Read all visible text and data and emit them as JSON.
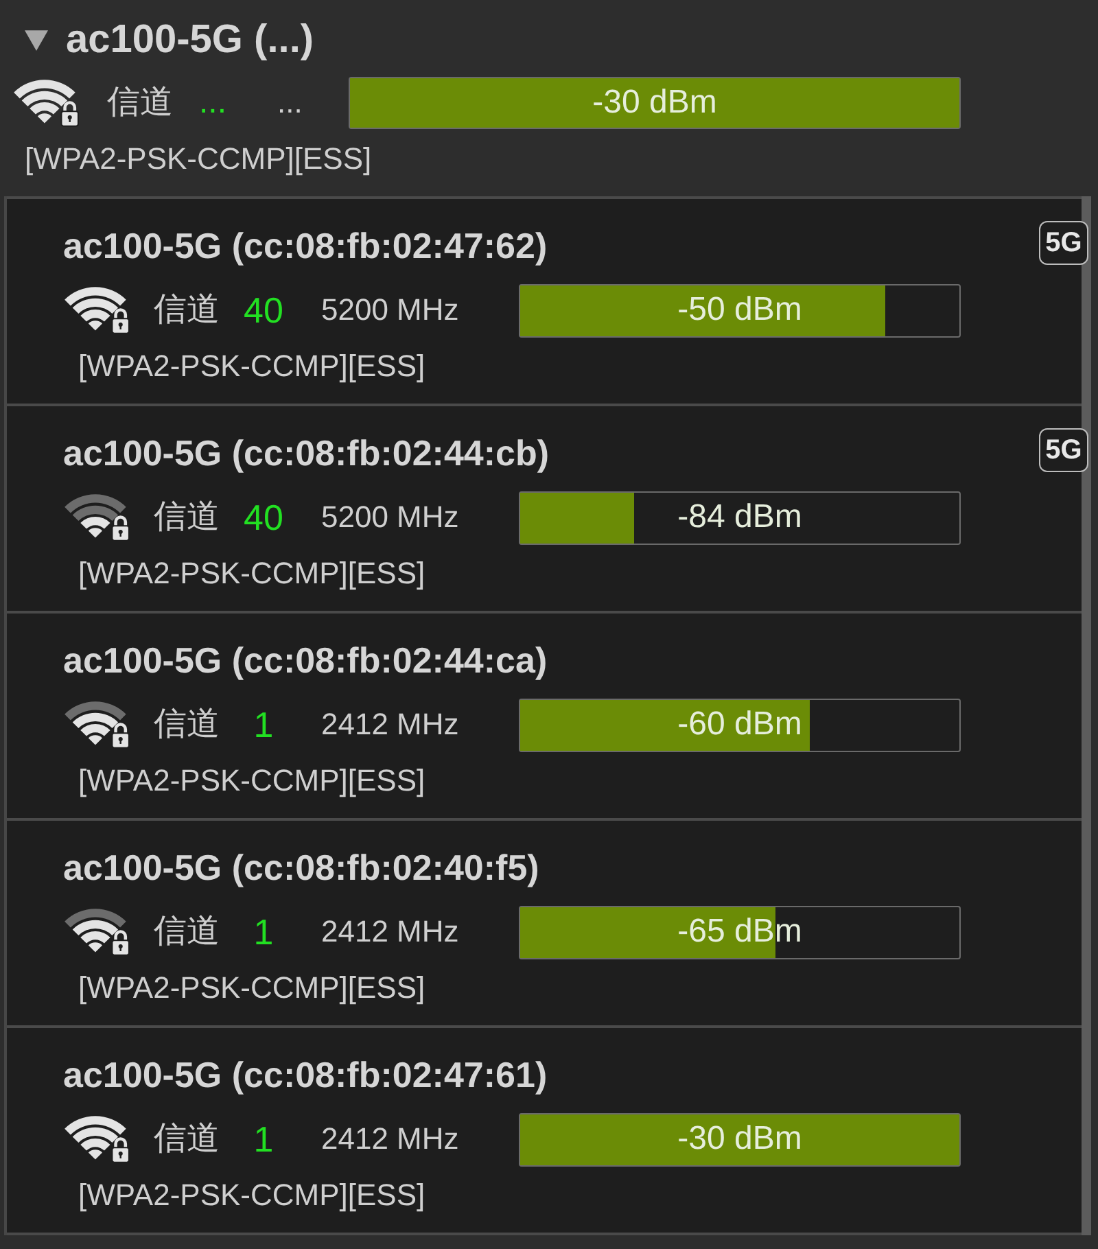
{
  "group": {
    "title": "ac100-5G (...)",
    "expanded": true,
    "channel_label": "信道",
    "channel": "...",
    "frequency": "...",
    "level": 1,
    "reading": "-30 dBm",
    "security": "[WPA2-PSK-CCMP][ESS]"
  },
  "networks": [
    {
      "name": "ac100-5G (cc:08:fb:02:47:62)",
      "band": "5G",
      "channel_label": "信道",
      "channel": "40",
      "frequency": "5200 MHz",
      "level": 0.83,
      "reading": "-50 dBm",
      "security": "[WPA2-PSK-CCMP][ESS]"
    },
    {
      "name": "ac100-5G (cc:08:fb:02:44:cb)",
      "band": "5G",
      "channel_label": "信道",
      "channel": "40",
      "frequency": "5200 MHz",
      "level": 0.26,
      "reading": "-84 dBm",
      "security": "[WPA2-PSK-CCMP][ESS]"
    },
    {
      "name": "ac100-5G (cc:08:fb:02:44:ca)",
      "channel_label": "信道",
      "channel": "1",
      "frequency": "2412 MHz",
      "level": 0.66,
      "reading": "-60 dBm",
      "security": "[WPA2-PSK-CCMP][ESS]"
    },
    {
      "name": "ac100-5G (cc:08:fb:02:40:f5)",
      "channel_label": "信道",
      "channel": "1",
      "frequency": "2412 MHz",
      "level": 0.58,
      "reading": "-65 dBm",
      "security": "[WPA2-PSK-CCMP][ESS]"
    },
    {
      "name": "ac100-5G (cc:08:fb:02:47:61)",
      "channel_label": "信道",
      "channel": "1",
      "frequency": "2412 MHz",
      "level": 1,
      "reading": "-30 dBm",
      "security": "[WPA2-PSK-CCMP][ESS]"
    }
  ]
}
